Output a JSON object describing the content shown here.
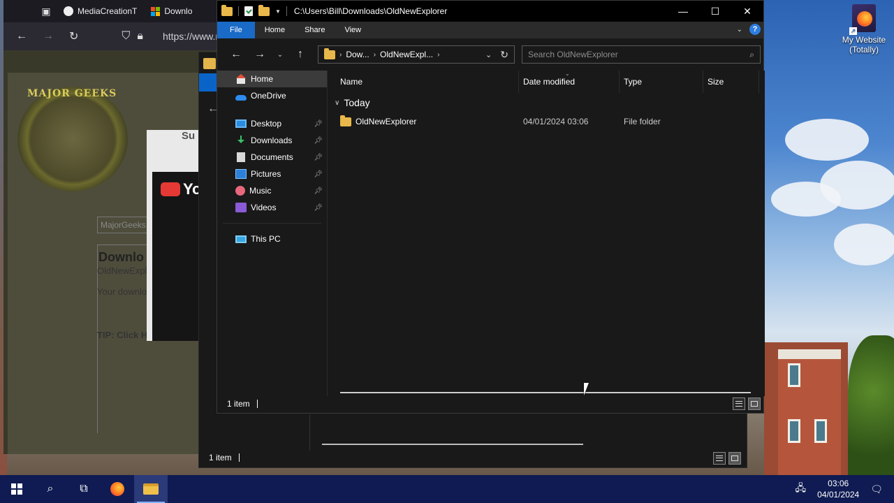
{
  "browser": {
    "tabs": [
      {
        "label": "MediaCreationT",
        "icon": "github-icon"
      },
      {
        "label": "Downlo",
        "icon": "windows-logo-icon"
      }
    ],
    "url": "https://www.m",
    "site_logo_text": "MAJOR GEEKS",
    "dialog_title": "Su",
    "youtube_text": "You",
    "search_placeholder": "MajorGeeks",
    "download_title": "Downlo",
    "download_sub": "OldNewExpl",
    "download_text": "Your downlo",
    "tip_text": "TIP: Click H"
  },
  "explorer_back": {
    "status": "1 item"
  },
  "explorer": {
    "title_path": "C:\\Users\\Bill\\Downloads\\OldNewExplorer",
    "window_buttons": {
      "minimize": "—",
      "maximize": "☐",
      "close": "✕"
    },
    "ribbon_tabs": [
      "File",
      "Home",
      "Share",
      "View"
    ],
    "breadcrumbs": [
      "Dow...",
      "OldNewExpl..."
    ],
    "search_placeholder": "Search OldNewExplorer",
    "nav": {
      "home": "Home",
      "onedrive": "OneDrive",
      "quick": [
        {
          "label": "Desktop",
          "icon": "desktop-icon"
        },
        {
          "label": "Downloads",
          "icon": "downloads-icon"
        },
        {
          "label": "Documents",
          "icon": "documents-icon"
        },
        {
          "label": "Pictures",
          "icon": "pictures-icon"
        },
        {
          "label": "Music",
          "icon": "music-icon"
        },
        {
          "label": "Videos",
          "icon": "videos-icon"
        }
      ],
      "thispc": "This PC"
    },
    "columns": {
      "name": "Name",
      "date": "Date modified",
      "type": "Type",
      "size": "Size"
    },
    "group": "Today",
    "files": [
      {
        "name": "OldNewExplorer",
        "date": "04/01/2024 03:06",
        "type": "File folder"
      }
    ],
    "status": "1 item",
    "accent": "#1a6ac7"
  },
  "desktop": {
    "icon_label": "My Website (Totally)"
  },
  "taskbar": {
    "time": "03:06",
    "date": "04/01/2024"
  }
}
